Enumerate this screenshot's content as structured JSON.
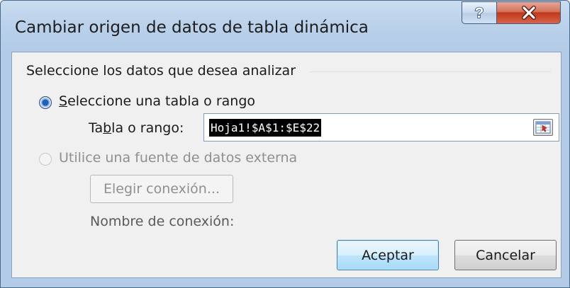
{
  "window": {
    "title": "Cambiar origen de datos de tabla dinámica",
    "help_label": "?",
    "close_label": "X"
  },
  "group": {
    "label": "Seleccione los datos que desea analizar"
  },
  "option_table": {
    "label_first": "S",
    "label_rest": "eleccione una tabla o rango",
    "selected": true
  },
  "range_field": {
    "label_pre": "Ta",
    "label_access": "b",
    "label_post": "la o rango:",
    "value": "Hoja1!$A$1:$E$22",
    "collapse_icon": "range-select-icon"
  },
  "option_external": {
    "label": "Utilice una fuente de datos externa",
    "selected": false,
    "enabled": false
  },
  "connection": {
    "button_label": "Elegir conexión...",
    "name_label": "Nombre de conexión:"
  },
  "buttons": {
    "ok": "Aceptar",
    "cancel": "Cancelar"
  },
  "colors": {
    "title_gradient_top": "#c9dcef",
    "close_button": "#c0391b",
    "selection": "#000000",
    "disabled_text": "#8f8f8f"
  }
}
